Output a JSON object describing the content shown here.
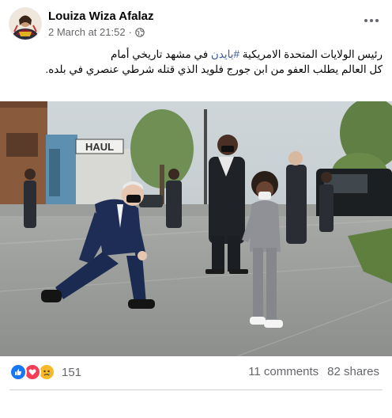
{
  "post": {
    "author": "Louiza Wiza Afalaz",
    "timestamp": "2 March at 21:52",
    "separator": "·",
    "privacy_icon": "globe-icon",
    "text_line1_before": "رئيس الولايات المتحدة الامريكية ",
    "hashtag": "#بايدن",
    "text_line1_after": " في مشهد تاريخي أمام",
    "text_line2": "كل العالم  يطلب العفو من ابن جورج فلويد الذي قتله شرطي عنصري في بلده."
  },
  "photo": {
    "sign_text": "HAUL"
  },
  "footer": {
    "reactions": [
      "like",
      "love",
      "sad"
    ],
    "reaction_count": "151",
    "comments": "11 comments",
    "shares": "82 shares"
  },
  "colors": {
    "like": "#1877f2",
    "love": "#f33e58",
    "sad": "#f7b928",
    "link": "#385898",
    "meta": "#65676b"
  }
}
